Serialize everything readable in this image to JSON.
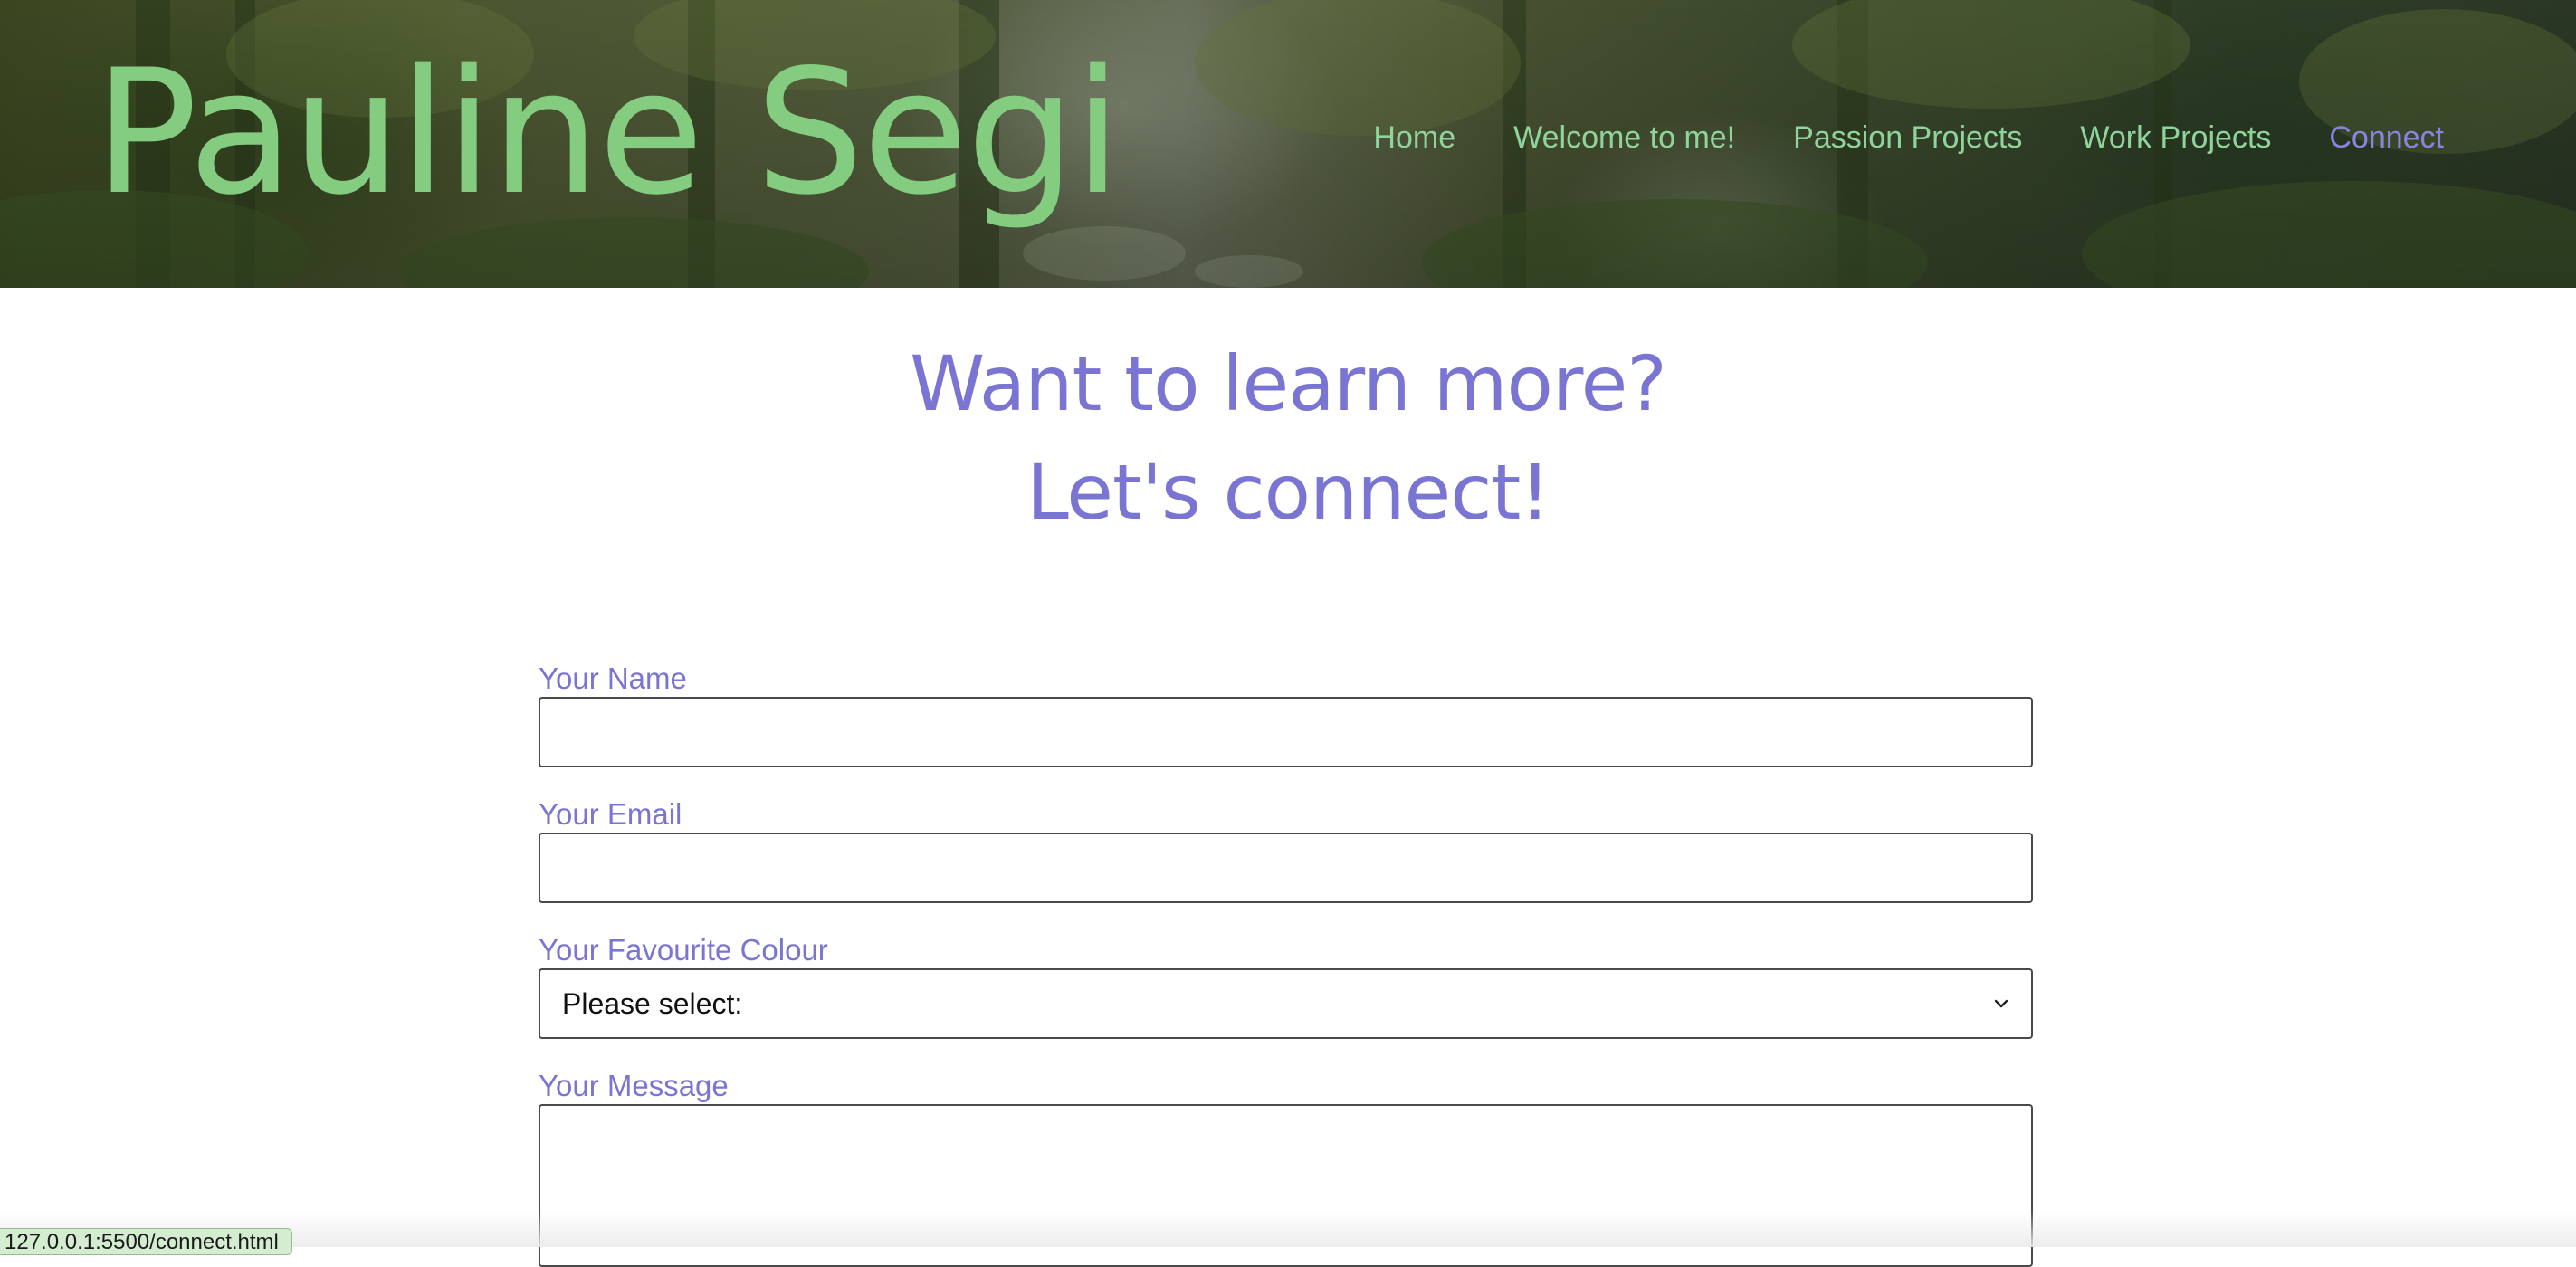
{
  "header": {
    "brand": "Pauline Segi",
    "nav": [
      {
        "label": "Home"
      },
      {
        "label": "Welcome to me!"
      },
      {
        "label": "Passion Projects"
      },
      {
        "label": "Work Projects"
      },
      {
        "label": "Connect",
        "active": true
      }
    ]
  },
  "headings": {
    "line1": "Want to learn more?",
    "line2": "Let's connect!"
  },
  "form": {
    "name_label": "Your Name",
    "name_value": "",
    "email_label": "Your Email",
    "email_value": "",
    "colour_label": "Your Favourite Colour",
    "colour_selected": "Please select:",
    "message_label": "Your Message",
    "message_value": ""
  },
  "status": {
    "url": "127.0.0.1:5500/connect.html"
  },
  "colors": {
    "brand_green": "#84cc7f",
    "nav_green": "#8fd49a",
    "accent_purple": "#7a74d2",
    "nav_active": "#8a84e0"
  }
}
